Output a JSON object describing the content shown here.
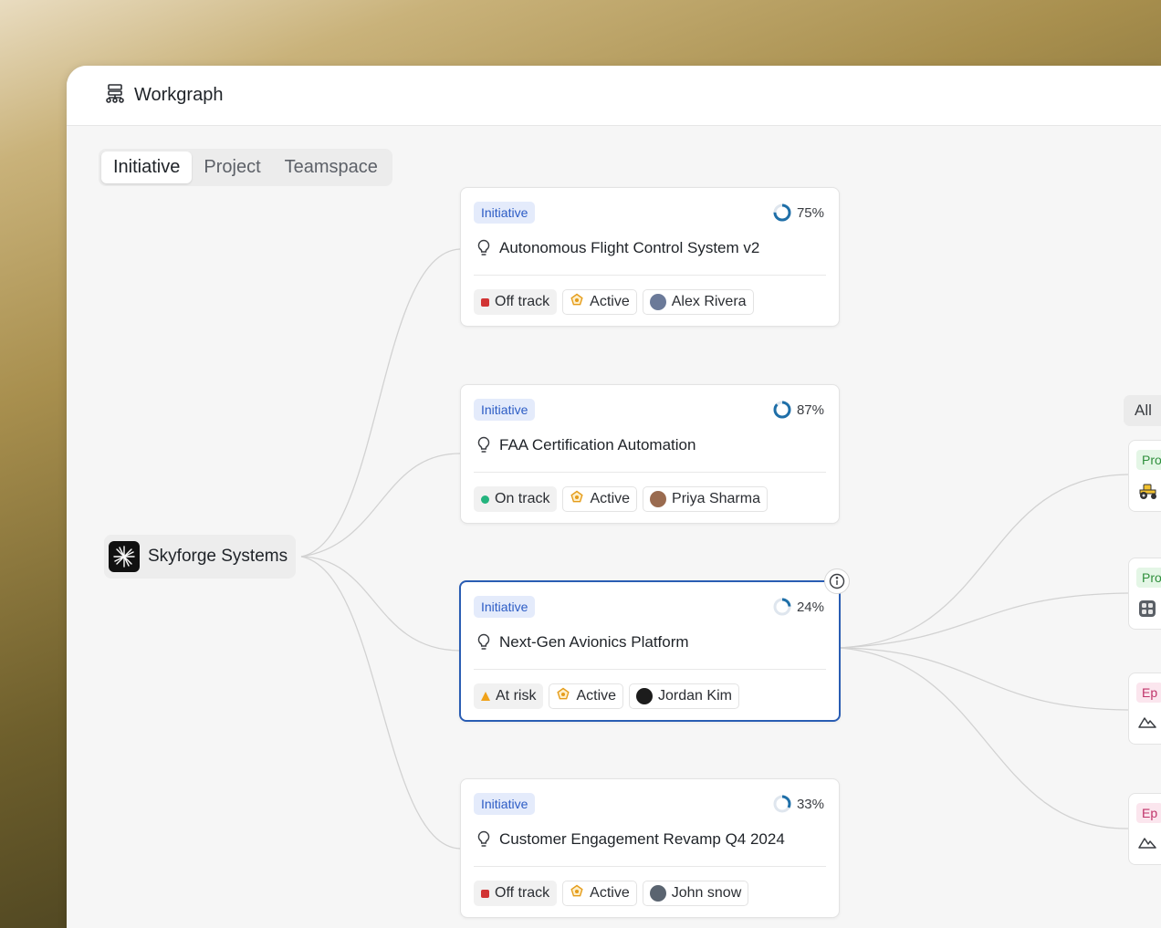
{
  "app": {
    "title": "Workgraph"
  },
  "tabs": [
    {
      "label": "Initiative",
      "active": true
    },
    {
      "label": "Project",
      "active": false
    },
    {
      "label": "Teamspace",
      "active": false
    }
  ],
  "root": {
    "name": "Skyforge Systems"
  },
  "initiatives": [
    {
      "badge": "Initiative",
      "progress": "75%",
      "progress_value": 0.75,
      "title": "Autonomous Flight Control System v2",
      "status": "Off track",
      "status_type": "off",
      "state": "Active",
      "owner": "Alex Rivera",
      "avatar_color": "#6b7a99"
    },
    {
      "badge": "Initiative",
      "progress": "87%",
      "progress_value": 0.87,
      "title": "FAA Certification Automation",
      "status": "On track",
      "status_type": "on",
      "state": "Active",
      "owner": "Priya Sharma",
      "avatar_color": "#9a6b4f"
    },
    {
      "badge": "Initiative",
      "progress": "24%",
      "progress_value": 0.24,
      "title": "Next-Gen Avionics Platform",
      "status": "At risk",
      "status_type": "risk",
      "state": "Active",
      "owner": "Jordan Kim",
      "avatar_color": "#1c1c1c"
    },
    {
      "badge": "Initiative",
      "progress": "33%",
      "progress_value": 0.33,
      "title": "Customer Engagement Revamp Q4 2024",
      "status": "Off track",
      "status_type": "off",
      "state": "Active",
      "owner": "John snow",
      "avatar_color": "#5a6470"
    }
  ],
  "right_panel": {
    "filter_label": "All",
    "items": [
      {
        "badge": "Pro",
        "kind": "pro",
        "icon": "tractor-icon"
      },
      {
        "badge": "Pro",
        "kind": "pro",
        "icon": "apps-grid-icon"
      },
      {
        "badge": "Ep",
        "kind": "ep",
        "icon": "mountain-icon"
      },
      {
        "badge": "Ep",
        "kind": "ep",
        "icon": "mountain-icon"
      }
    ]
  },
  "colors": {
    "accent": "#2a5db3",
    "badge_bg": "#e4ebfb",
    "badge_text": "#2c5cc5",
    "off_track": "#d13434",
    "on_track": "#24b47e",
    "at_risk": "#f0a21a",
    "ring": "#1f6fa8"
  }
}
